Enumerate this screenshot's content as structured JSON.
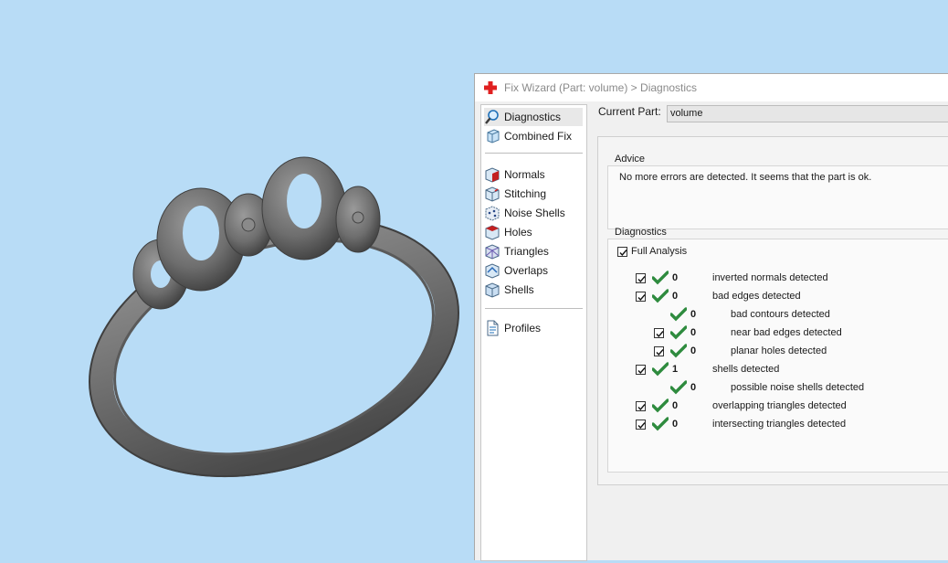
{
  "window": {
    "title": "Fix Wizard (Part: volume) > Diagnostics"
  },
  "sidebar": {
    "items": [
      {
        "label": "Diagnostics",
        "icon": "magnifier-icon",
        "selected": true
      },
      {
        "label": "Combined Fix",
        "icon": "combined-fix-icon"
      },
      {
        "label": "Normals",
        "icon": "normals-icon"
      },
      {
        "label": "Stitching",
        "icon": "stitching-icon"
      },
      {
        "label": "Noise Shells",
        "icon": "noise-shells-icon"
      },
      {
        "label": "Holes",
        "icon": "holes-icon"
      },
      {
        "label": "Triangles",
        "icon": "triangles-icon"
      },
      {
        "label": "Overlaps",
        "icon": "overlaps-icon"
      },
      {
        "label": "Shells",
        "icon": "shells-icon"
      },
      {
        "label": "Profiles",
        "icon": "profiles-icon"
      }
    ]
  },
  "current_part": {
    "label": "Current Part:",
    "value": "volume"
  },
  "advice": {
    "title": "Advice",
    "text": "No more errors are detected. It seems that the part is ok."
  },
  "diagnostics": {
    "title": "Diagnostics",
    "full_analysis_label": "Full Analysis",
    "full_analysis_checked": true,
    "rows": [
      {
        "count": "0",
        "label": "inverted normals detected",
        "checkbox": true
      },
      {
        "count": "0",
        "label": "bad edges detected",
        "checkbox": true
      },
      {
        "count": "0",
        "label": "bad contours detected",
        "checkbox": false
      },
      {
        "count": "0",
        "label": "near bad edges detected",
        "checkbox": true
      },
      {
        "count": "0",
        "label": "planar holes detected",
        "checkbox": true
      },
      {
        "count": "1",
        "label": "shells detected",
        "checkbox": true
      },
      {
        "count": "0",
        "label": "possible noise shells detected",
        "checkbox": false
      },
      {
        "count": "0",
        "label": "overlapping triangles detected",
        "checkbox": true
      },
      {
        "count": "0",
        "label": "intersecting triangles detected",
        "checkbox": true
      }
    ]
  },
  "colors": {
    "viewport_bg": "#b8dcf6",
    "check_green": "#2e8b3e",
    "app_icon_red": "#e02020",
    "model_gray": "#6f6f6f"
  }
}
